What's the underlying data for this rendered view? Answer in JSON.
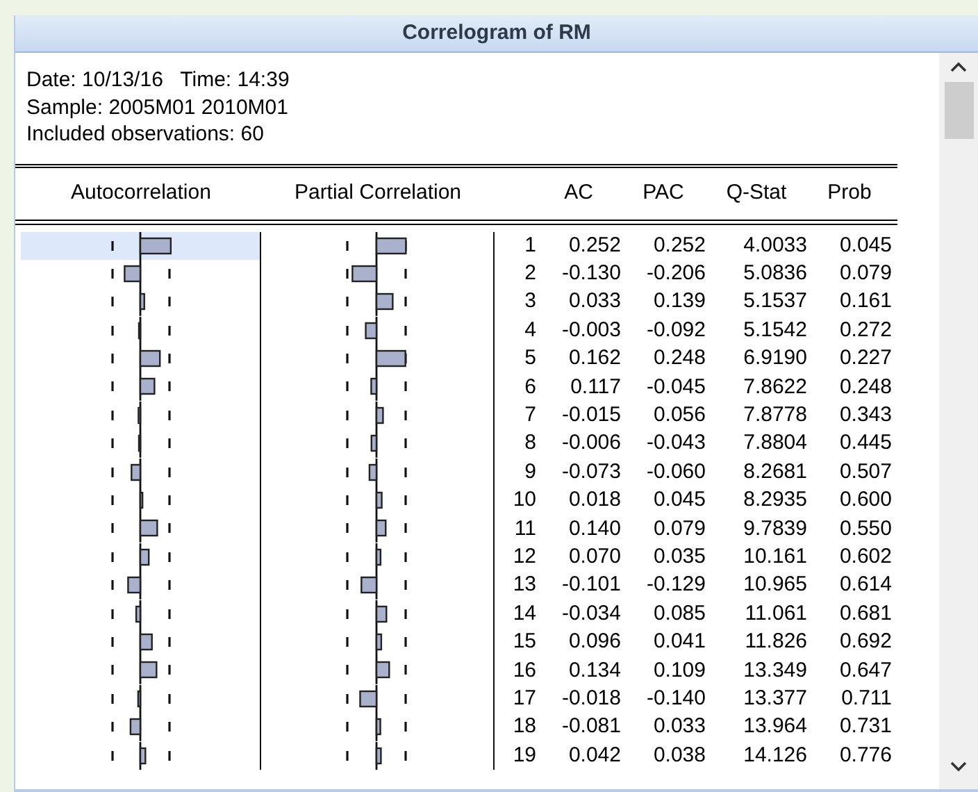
{
  "window": {
    "title": "Correlogram of RM"
  },
  "info": [
    "Date: 10/13/16   Time: 14:39",
    "Sample: 2005M01 2010M01",
    "Included observations: 60"
  ],
  "columns": [
    "Autocorrelation",
    "Partial Correlation",
    "AC",
    "PAC",
    "Q-Stat",
    "Prob"
  ],
  "rows": [
    {
      "lag": "1",
      "ac": "0.252",
      "pac": "0.252",
      "q_stat": "4.0033",
      "prob": "0.045",
      "selected": true
    },
    {
      "lag": "2",
      "ac": "-0.130",
      "pac": "-0.206",
      "q_stat": "5.0836",
      "prob": "0.079",
      "selected": false
    },
    {
      "lag": "3",
      "ac": "0.033",
      "pac": "0.139",
      "q_stat": "5.1537",
      "prob": "0.161",
      "selected": false
    },
    {
      "lag": "4",
      "ac": "-0.003",
      "pac": "-0.092",
      "q_stat": "5.1542",
      "prob": "0.272",
      "selected": false
    },
    {
      "lag": "5",
      "ac": "0.162",
      "pac": "0.248",
      "q_stat": "6.9190",
      "prob": "0.227",
      "selected": false
    },
    {
      "lag": "6",
      "ac": "0.117",
      "pac": "-0.045",
      "q_stat": "7.8622",
      "prob": "0.248",
      "selected": false
    },
    {
      "lag": "7",
      "ac": "-0.015",
      "pac": "0.056",
      "q_stat": "7.8778",
      "prob": "0.343",
      "selected": false
    },
    {
      "lag": "8",
      "ac": "-0.006",
      "pac": "-0.043",
      "q_stat": "7.8804",
      "prob": "0.445",
      "selected": false
    },
    {
      "lag": "9",
      "ac": "-0.073",
      "pac": "-0.060",
      "q_stat": "8.2681",
      "prob": "0.507",
      "selected": false
    },
    {
      "lag": "10",
      "ac": "0.018",
      "pac": "0.045",
      "q_stat": "8.2935",
      "prob": "0.600",
      "selected": false
    },
    {
      "lag": "11",
      "ac": "0.140",
      "pac": "0.079",
      "q_stat": "9.7839",
      "prob": "0.550",
      "selected": false
    },
    {
      "lag": "12",
      "ac": "0.070",
      "pac": "0.035",
      "q_stat": "10.161",
      "prob": "0.602",
      "selected": false
    },
    {
      "lag": "13",
      "ac": "-0.101",
      "pac": "-0.129",
      "q_stat": "10.965",
      "prob": "0.614",
      "selected": false
    },
    {
      "lag": "14",
      "ac": "-0.034",
      "pac": "0.085",
      "q_stat": "11.061",
      "prob": "0.681",
      "selected": false
    },
    {
      "lag": "15",
      "ac": "0.096",
      "pac": "0.041",
      "q_stat": "11.826",
      "prob": "0.692",
      "selected": false
    },
    {
      "lag": "16",
      "ac": "0.134",
      "pac": "0.109",
      "q_stat": "13.349",
      "prob": "0.647",
      "selected": false
    },
    {
      "lag": "17",
      "ac": "-0.018",
      "pac": "-0.140",
      "q_stat": "13.377",
      "prob": "0.711",
      "selected": false
    },
    {
      "lag": "18",
      "ac": "-0.081",
      "pac": "0.033",
      "q_stat": "13.964",
      "prob": "0.731",
      "selected": false
    },
    {
      "lag": "19",
      "ac": "0.042",
      "pac": "0.038",
      "q_stat": "14.126",
      "prob": "0.776",
      "selected": false
    }
  ]
}
